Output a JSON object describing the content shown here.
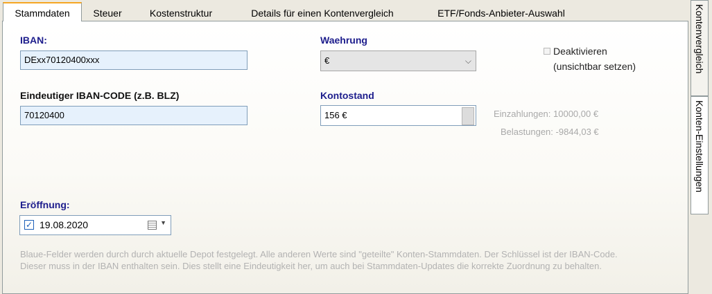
{
  "tabs": [
    {
      "label": "Stammdaten"
    },
    {
      "label": "Steuer"
    },
    {
      "label": "Kostenstruktur"
    },
    {
      "label": "Details für einen Kontenvergleich"
    },
    {
      "label": "ETF/Fonds-Anbieter-Auswahl"
    }
  ],
  "side_tabs": [
    {
      "label": "Kontenvergleich"
    },
    {
      "label": "Konten-Einstellungen"
    }
  ],
  "form": {
    "iban_label": "IBAN:",
    "iban_value": "DExx70120400xxx",
    "code_label": "Eindeutiger IBAN-CODE (z.B. BLZ)",
    "code_value": "70120400",
    "currency_label": "Waehrung",
    "currency_value": "€",
    "balance_label": "Kontostand",
    "balance_value": "156 €",
    "deactivate_line1": "Deaktivieren",
    "deactivate_line2": "(unsichtbar setzen)",
    "deactivate_checked": false,
    "deposits": "Einzahlungen:  10000,00 €",
    "charges": "Belastungen:  -9844,03 €",
    "opening_label": "Eröffnung:",
    "opening_date": "19.08.2020",
    "opening_checked": true,
    "note": "Blaue-Felder werden durch durch aktuelle Depot festgelegt. Alle anderen Werte sind \"geteilte\" Konten-Stammdaten. Der Schlüssel ist der IBAN-Code. Dieser muss in der IBAN enthalten sein. Dies stellt eine Eindeutigkeit her, um auch bei Stammdaten-Updates die korrekte Zuordnung zu behalten."
  },
  "colors": {
    "label_blue": "#1c1c8c",
    "field_blue": "#e6f1fc",
    "tab_accent": "#f5a623"
  },
  "icons": [
    "chevron-down-icon",
    "calendar-icon",
    "checkbox-icon"
  ]
}
